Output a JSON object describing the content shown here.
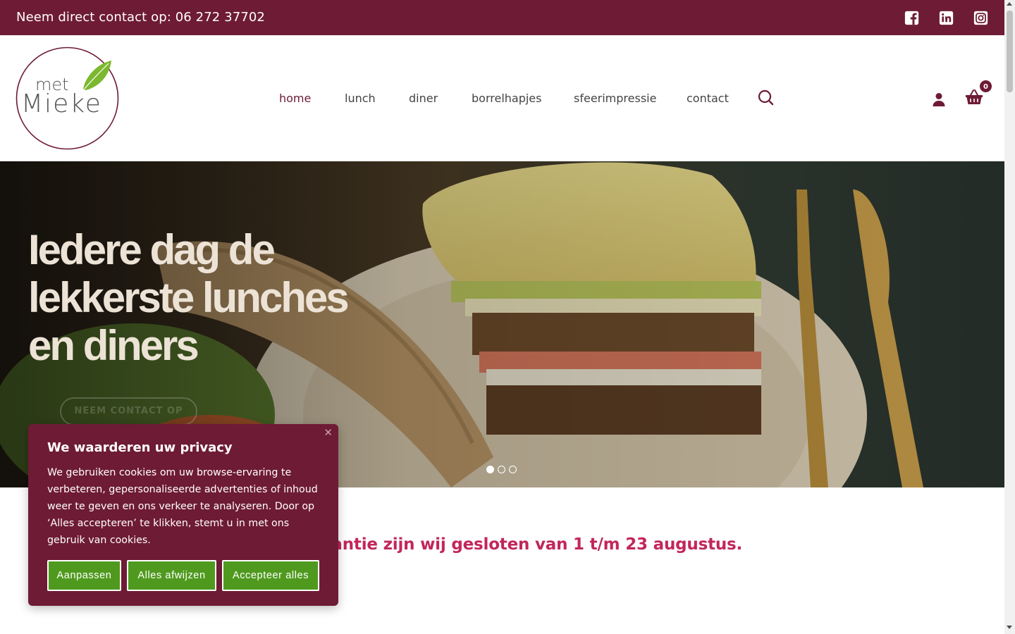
{
  "topbar": {
    "contact_text": "Neem direct contact op: 06 272 37702",
    "social": [
      {
        "icon": "facebook-icon"
      },
      {
        "icon": "linkedin-icon"
      },
      {
        "icon": "instagram-icon"
      }
    ]
  },
  "logo": {
    "line1": "met",
    "line2": "Mieke"
  },
  "nav": {
    "items": [
      {
        "label": "home",
        "active": true
      },
      {
        "label": "lunch"
      },
      {
        "label": "diner"
      },
      {
        "label": "borrelhapjes"
      },
      {
        "label": "sfeerimpressie"
      },
      {
        "label": "contact"
      }
    ]
  },
  "cart": {
    "count": "0"
  },
  "hero": {
    "title_line1": "Iedere dag de",
    "title_line2": "lekkerste lunches",
    "title_line3": "en diners",
    "cta_label": "NEEM CONTACT OP",
    "slides_total": 3,
    "active_slide": 1
  },
  "notice": {
    "visible_text": "akantie zijn wij gesloten van 1 t/m 23 augustus."
  },
  "cookie": {
    "close": "✕",
    "title": "We waarderen uw privacy",
    "text": "We gebruiken cookies om uw browse-ervaring te verbeteren, gepersonaliseerde advertenties of inhoud weer te geven en ons verkeer te analyseren. Door op ‘Alles accepteren’ te klikken, stemt u in met ons gebruik van cookies.",
    "buttons": {
      "customize": "Aanpassen",
      "reject": "Alles afwijzen",
      "accept": "Accepteer alles"
    }
  },
  "colors": {
    "brand": "#6e1b35",
    "accent_green": "#4f9a1e",
    "notice_red": "#c2265c"
  }
}
